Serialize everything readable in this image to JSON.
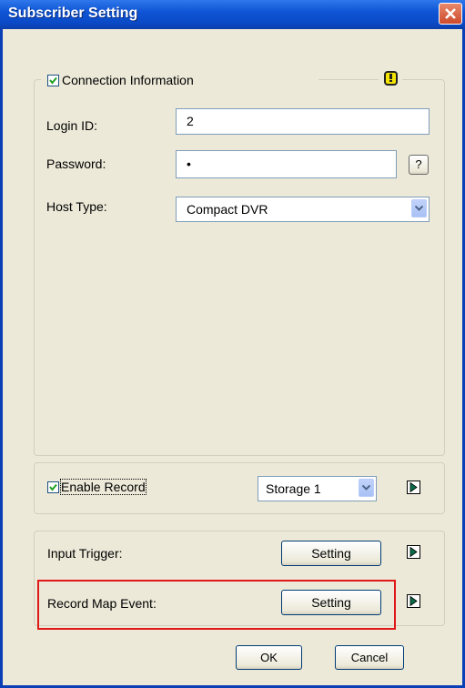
{
  "window": {
    "title": "Subscriber Setting"
  },
  "connection": {
    "checkbox_label": "Connection Information",
    "checked": true,
    "login_label": "Login ID:",
    "login_value": "2",
    "password_label": "Password:",
    "password_value": "•",
    "help_label": "?",
    "host_label": "Host Type:",
    "host_value": "Compact DVR"
  },
  "record": {
    "checkbox_label": "Enable Record",
    "checked": true,
    "storage_value": "Storage 1"
  },
  "events": {
    "input_trigger_label": "Input Trigger:",
    "input_trigger_button": "Setting",
    "record_map_label": "Record Map Event:",
    "record_map_button": "Setting"
  },
  "footer": {
    "ok_label": "OK",
    "cancel_label": "Cancel"
  },
  "colors": {
    "title_bar": "#0a49c6",
    "highlight": "#e01818",
    "warning_icon": "#f5e400",
    "arrow": "#0a6e4a"
  }
}
